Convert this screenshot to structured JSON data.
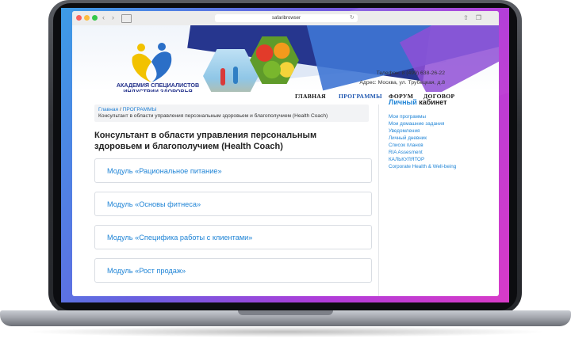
{
  "browser": {
    "address": "safaribrowser",
    "reload": "↻"
  },
  "site": {
    "logo_text": "АКАДЕМИЯ СПЕЦИАЛИСТОВ ИНДУСТРИИ ЗДОРОВЬЯ",
    "phone": "Телефон: 8 (499) 638-26-22",
    "address": "Адрес: Москва, ул. Трубецкая, д.8",
    "nav": [
      {
        "label": "ГЛАВНАЯ",
        "active": false
      },
      {
        "label": "ПРОГРАММЫ",
        "active": true
      },
      {
        "label": "ФОРУМ",
        "active": false
      },
      {
        "label": "ДОГОВОР",
        "active": false
      }
    ]
  },
  "breadcrumb": {
    "home": "Главная",
    "separator": "/",
    "section": "ПРОГРАММЫ",
    "current": "Консультант в области управления персональным здоровьем и благополучием (Health Coach)"
  },
  "page": {
    "title": "Консультант в области управления персональным здоровьем и благополучием (Health Coach)",
    "modules": [
      "Модуль «Рациональное питание»",
      "Модуль «Основы фитнеса»",
      "Модуль «Специфика работы с клиентами»",
      "Модуль «Рост продаж»"
    ]
  },
  "sidebar": {
    "title_highlight": "Личный",
    "title_rest": " кабинет",
    "links": [
      "Мои программы",
      "Мои домашние задания",
      "Уведомления",
      "Личный дневник",
      "Список планов",
      "RIA Assesment",
      "КАЛЬКУЛЯТОР",
      "Corporate Health & Well-being"
    ]
  },
  "colors": {
    "accent": "#1f84d6",
    "nav_active": "#1f57b0",
    "brand": "#22308a"
  }
}
